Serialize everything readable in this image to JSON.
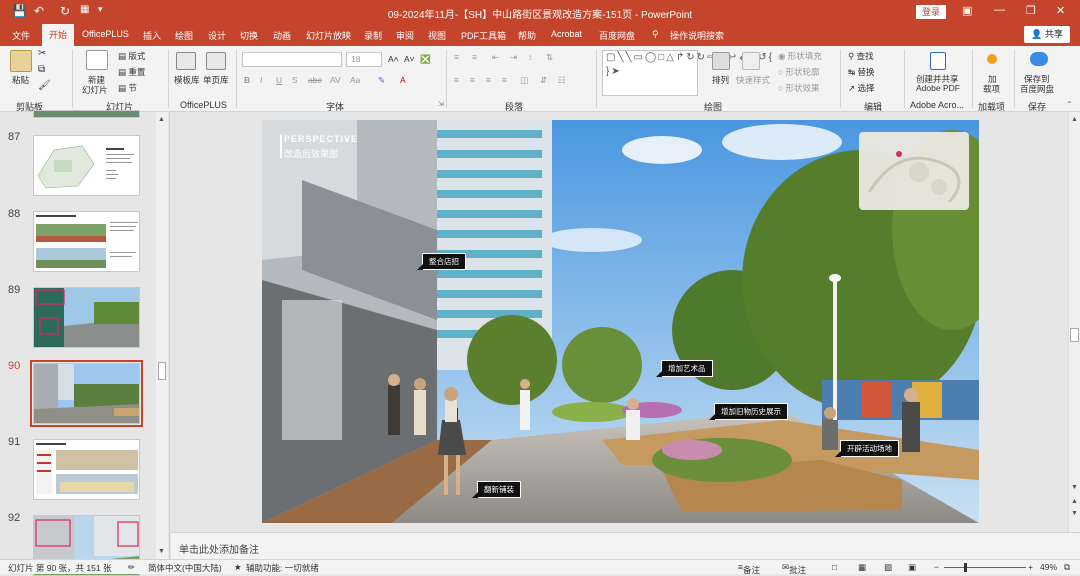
{
  "titlebar": {
    "title": "09-2024年11月-【SH】中山路街区景观改造方案-151页 - PowerPoint",
    "login_label": "登录",
    "save_icon": "save-icon",
    "undo_icon": "undo-icon",
    "redo_icon": "redo-icon"
  },
  "tabs": [
    "文件",
    "开始",
    "OfficePLUS",
    "插入",
    "绘图",
    "设计",
    "切换",
    "动画",
    "幻灯片放映",
    "录制",
    "审阅",
    "视图",
    "PDF工具箱",
    "帮助",
    "Acrobat",
    "百度网盘",
    "操作说明搜索"
  ],
  "share_label": "共享",
  "ribbon": {
    "clipboard": {
      "paste": "粘贴",
      "label": "剪贴板"
    },
    "slides": {
      "new_slide_line1": "新建",
      "new_slide_line2": "幻灯片",
      "layout": "版式",
      "reset": "重置",
      "section": "节",
      "label": "幻灯片"
    },
    "officeplus": {
      "template": "模板库",
      "single": "单页库",
      "label": "OfficePLUS"
    },
    "font": {
      "size": "18",
      "label": "字体"
    },
    "paragraph": {
      "label": "段落"
    },
    "drawing": {
      "arrange": "排列",
      "quick_styles": "快速样式",
      "fill": "形状填充",
      "outline": "形状轮廓",
      "effects": "形状效果",
      "label": "绘图"
    },
    "editing": {
      "find": "查找",
      "replace": "替换",
      "select": "选择",
      "label": "编辑"
    },
    "adobe": {
      "line1": "创建并共享",
      "line2": "Adobe PDF",
      "label": "Adobe Acro..."
    },
    "addins": {
      "line1": "加",
      "line2": "载项",
      "label": "加载项"
    },
    "save": {
      "line1": "保存到",
      "line2": "百度网盘",
      "label": "保存"
    }
  },
  "thumbnails": [
    {
      "num": "87"
    },
    {
      "num": "88"
    },
    {
      "num": "89"
    },
    {
      "num": "90"
    },
    {
      "num": "91"
    },
    {
      "num": "92"
    }
  ],
  "slide": {
    "heading_en": "PERSPECTIVE",
    "heading_cn": "改造后效果图",
    "callouts": [
      "整合店招",
      "增加艺术品",
      "增加旧物历史展示",
      "开辟活动场地",
      "翻新铺装"
    ]
  },
  "notes_placeholder": "单击此处添加备注",
  "statusbar": {
    "slide_info": "幻灯片 第 90 张，共 151 张",
    "language": "简体中文(中国大陆)",
    "accessibility": "辅助功能: 一切就绪",
    "notes": "备注",
    "comments": "批注",
    "zoom": "49%"
  },
  "colors": {
    "accent": "#c4452b",
    "ribbon_bg": "#f3f3f3"
  }
}
